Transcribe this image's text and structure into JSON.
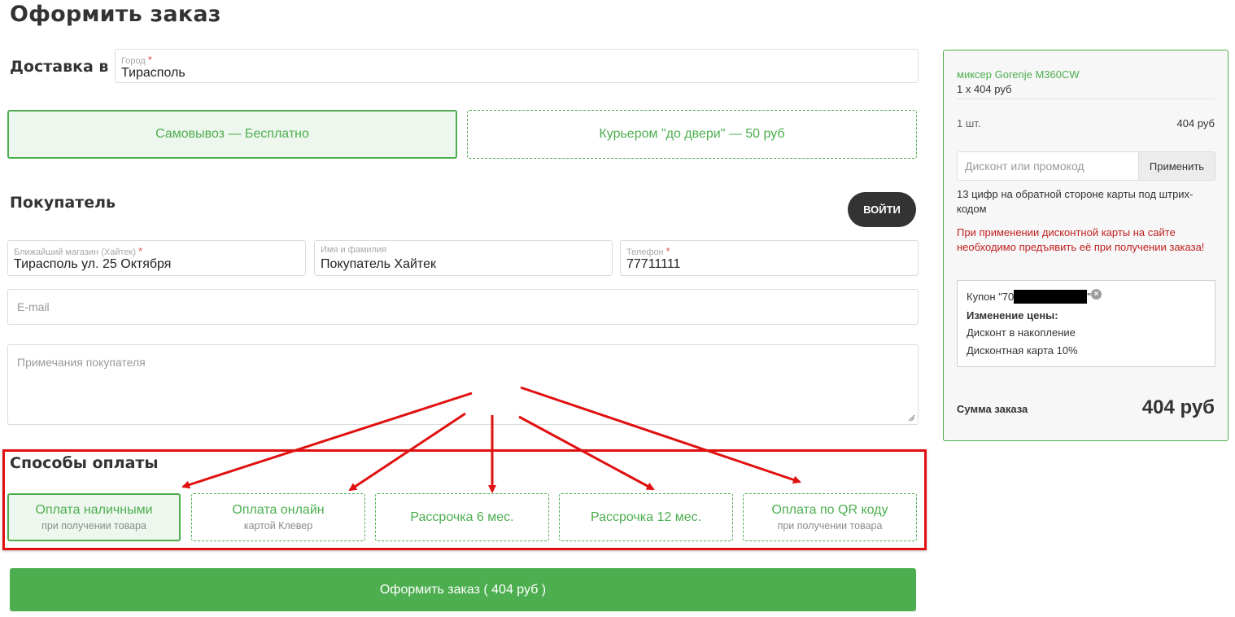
{
  "page": {
    "title": "Оформить заказ"
  },
  "delivery": {
    "label": "Доставка в",
    "city_label": "Город",
    "city_value": "Тирасполь",
    "required_mark": "*",
    "options": [
      {
        "label": "Самовывоз — Бесплатно",
        "selected": true
      },
      {
        "label": "Курьером \"до двери\" — 50 руб",
        "selected": false
      }
    ]
  },
  "buyer": {
    "label": "Покупатель",
    "login_button": "ВОЙТИ",
    "store_label": "Ближайший магазин (Хайтек)",
    "store_value": "Тирасполь ул. 25 Октября",
    "name_label": "Имя и фамилия",
    "name_value": "Покупатель Хайтек",
    "phone_label": "Телефон",
    "phone_value": "77711111",
    "email_placeholder": "E-mail",
    "notes_placeholder": "Примечания покупателя"
  },
  "payment": {
    "label": "Способы оплаты",
    "options": [
      {
        "main": "Оплата наличными",
        "sub": "при получении товара",
        "selected": true
      },
      {
        "main": "Оплата онлайн",
        "sub": "картой Клевер",
        "selected": false
      },
      {
        "main": "Рассрочка 6 мес.",
        "sub": "",
        "selected": false
      },
      {
        "main": "Рассрочка 12 мес.",
        "sub": "",
        "selected": false
      },
      {
        "main": "Оплата по QR коду",
        "sub": "при получении товара",
        "selected": false
      }
    ]
  },
  "submit": {
    "label": "Оформить заказ ( 404 руб )"
  },
  "summary": {
    "item_name": "миксер Gorenje M360CW",
    "item_qty": "1 x 404 руб",
    "count_label": "1 шт.",
    "count_value": "404 руб",
    "promo_placeholder": "Дисконт или промокод",
    "apply_button": "Применить",
    "hint": "13 цифр на обратной стороне карты под штрих-кодом",
    "warning": "При применении дисконтной карты на сайте необходимо предъявить её при получении заказа!",
    "coupon": {
      "prefix": "Купон \"70",
      "suffix": "\"",
      "price_change_label": "Изменение цены:",
      "lines": [
        "Дисконт в накопление",
        "Дисконтная карта 10%"
      ]
    },
    "total_label": "Сумма заказа",
    "total_value": "404 руб"
  },
  "colors": {
    "accent": "#4cae4f",
    "annotation": "#e01010",
    "warning": "#c0201f"
  }
}
